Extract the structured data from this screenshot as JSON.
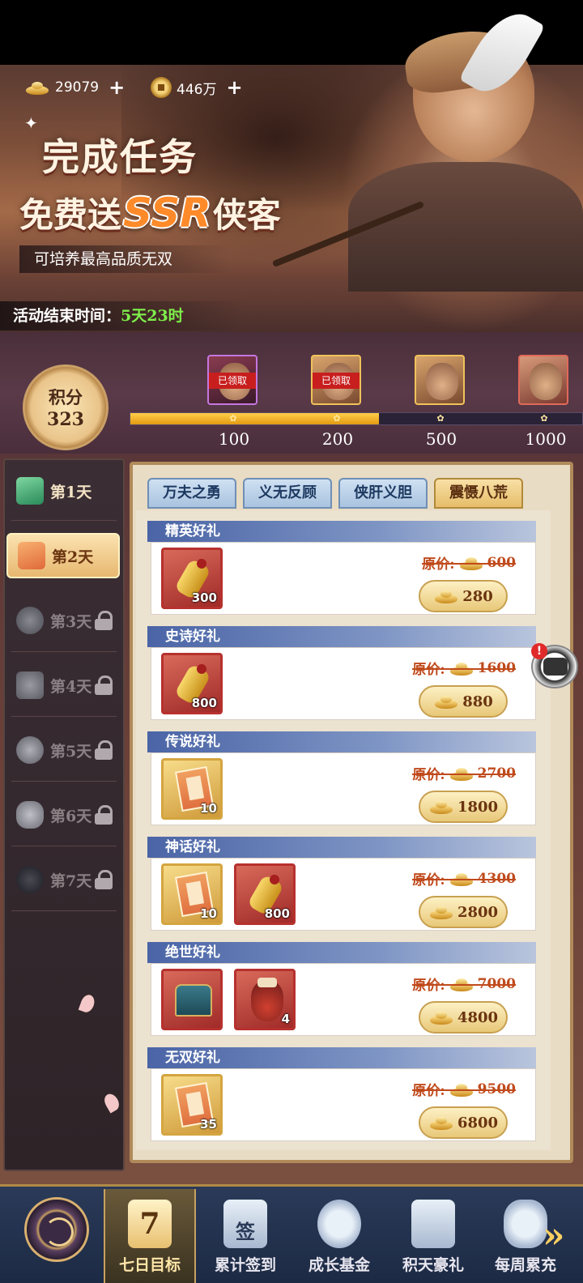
{
  "currency": {
    "ingot_amount": "29079",
    "coin_amount": "446万",
    "plus": "+"
  },
  "banner": {
    "title_line1": "完成任务",
    "title_line2_prefix": "免费送",
    "title_ssr": "SSR",
    "title_line2_suffix": "侠客",
    "subtitle": "可培养最高品质无双",
    "end_time_label": "活动结束时间：",
    "end_time_value": "5天23时"
  },
  "score": {
    "label": "积分",
    "value": "323",
    "progress_fraction": 0.55,
    "milestones": [
      {
        "value": "100",
        "status": "已领取",
        "claimed": true
      },
      {
        "value": "200",
        "status": "已领取",
        "claimed": true
      },
      {
        "value": "500",
        "status": "",
        "claimed": false
      },
      {
        "value": "1000",
        "status": "",
        "claimed": false
      }
    ]
  },
  "days": [
    {
      "label": "第1天",
      "locked": false,
      "active": false
    },
    {
      "label": "第2天",
      "locked": false,
      "active": true
    },
    {
      "label": "第3天",
      "locked": true,
      "active": false
    },
    {
      "label": "第4天",
      "locked": true,
      "active": false
    },
    {
      "label": "第5天",
      "locked": true,
      "active": false
    },
    {
      "label": "第6天",
      "locked": true,
      "active": false
    },
    {
      "label": "第7天",
      "locked": true,
      "active": false
    }
  ],
  "tabs": [
    {
      "label": "万夫之勇",
      "active": false
    },
    {
      "label": "义无反顾",
      "active": false
    },
    {
      "label": "侠肝义胆",
      "active": false
    },
    {
      "label": "震慑八荒",
      "active": true
    }
  ],
  "price_label": "原价:",
  "gifts": [
    {
      "title": "精英好礼",
      "items": [
        {
          "icon": "scroll",
          "count": "300"
        }
      ],
      "original_price": "600",
      "price": "280"
    },
    {
      "title": "史诗好礼",
      "items": [
        {
          "icon": "scroll",
          "count": "800"
        }
      ],
      "original_price": "1600",
      "price": "880"
    },
    {
      "title": "传说好礼",
      "items": [
        {
          "icon": "card",
          "count": "10"
        }
      ],
      "original_price": "2700",
      "price": "1800"
    },
    {
      "title": "神话好礼",
      "items": [
        {
          "icon": "card",
          "count": "10"
        },
        {
          "icon": "scroll",
          "count": "800"
        }
      ],
      "original_price": "4300",
      "price": "2800"
    },
    {
      "title": "绝世好礼",
      "items": [
        {
          "icon": "chest",
          "count": ""
        },
        {
          "icon": "jar",
          "count": "4"
        }
      ],
      "original_price": "7000",
      "price": "4800"
    },
    {
      "title": "无双好礼",
      "items": [
        {
          "icon": "card",
          "count": "35"
        }
      ],
      "original_price": "9500",
      "price": "6800"
    }
  ],
  "chat": {
    "alert": "!"
  },
  "nav": [
    {
      "label": "七日目标",
      "active": true,
      "icon": "calendar-7-icon"
    },
    {
      "label": "累计签到",
      "active": false,
      "icon": "sign-in-icon"
    },
    {
      "label": "成长基金",
      "active": false,
      "icon": "coins-icon"
    },
    {
      "label": "积天豪礼",
      "active": false,
      "icon": "gift-icon"
    },
    {
      "label": "每周累充",
      "active": false,
      "icon": "treasure-icon"
    }
  ],
  "nav_calendar_number": "7",
  "nav_sign_char": "签"
}
